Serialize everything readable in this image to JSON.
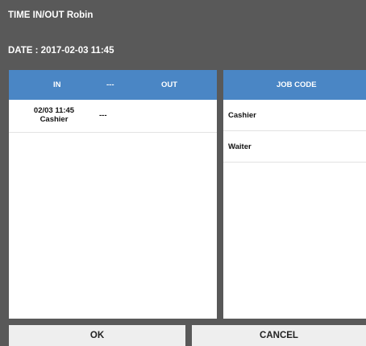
{
  "header": {
    "title": "TIME IN/OUT Robin",
    "date": "DATE : 2017-02-03 11:45"
  },
  "time_table": {
    "columns": {
      "in": "IN",
      "separator": "---",
      "out": "OUT"
    },
    "rows": [
      {
        "in_time": "02/03 11:45",
        "in_job": "Cashier",
        "out": "---"
      }
    ]
  },
  "job_table": {
    "header": "JOB CODE",
    "items": [
      "Cashier",
      "Waiter"
    ]
  },
  "buttons": {
    "ok": "OK",
    "cancel": "CANCEL"
  },
  "colors": {
    "background": "#595959",
    "header_blue": "#4a86c5",
    "button": "#eeeeee"
  }
}
